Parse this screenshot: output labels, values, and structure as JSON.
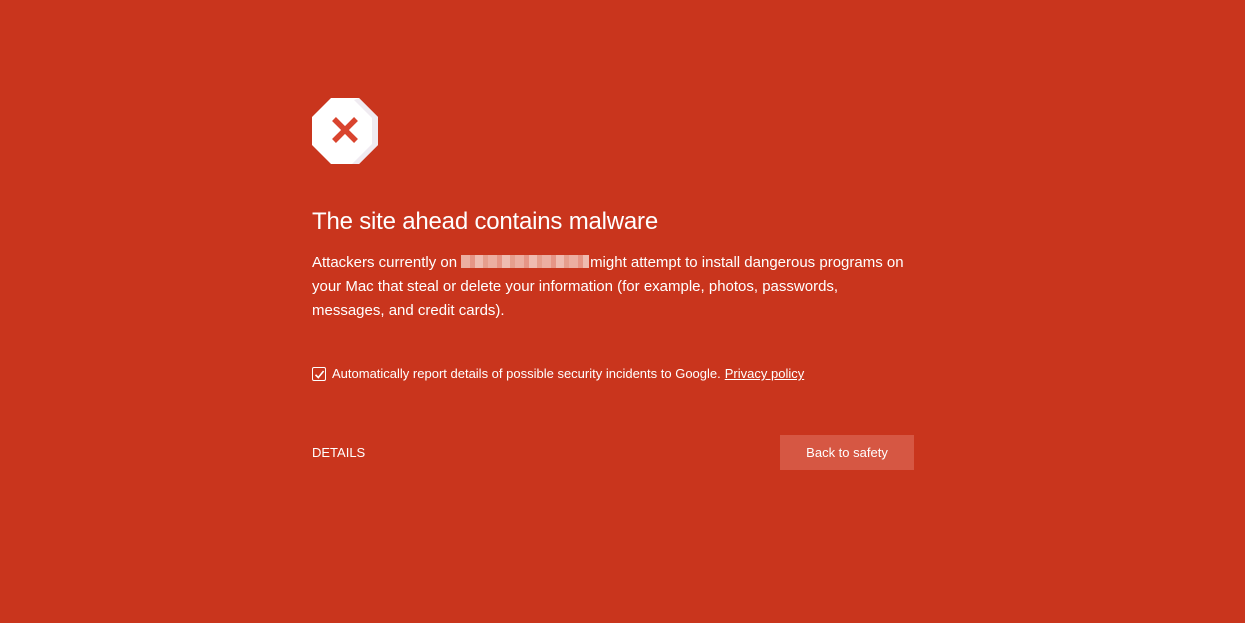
{
  "icon": {
    "name": "stop-sign-icon",
    "fill": "#ffffff",
    "cross_color": "#d9442e"
  },
  "heading": "The site ahead contains malware",
  "body": {
    "part1": "Attackers currently on",
    "part2": "might attempt to install dangerous programs on your Mac that steal or delete your information (for example, photos, passwords, messages, and credit cards)."
  },
  "report": {
    "checked": true,
    "label": "Automatically report details of possible security incidents to Google.",
    "privacy_link": "Privacy policy"
  },
  "actions": {
    "details_label": "DETAILS",
    "back_label": "Back to safety"
  },
  "colors": {
    "background": "#c9351d",
    "primary_button": "#d65743",
    "text": "#ffffff"
  }
}
